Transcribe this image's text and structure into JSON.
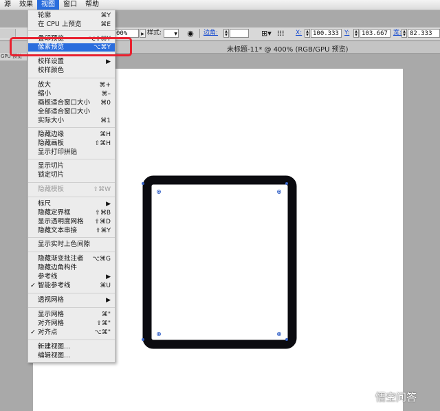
{
  "menubar": {
    "items": [
      {
        "label": "源",
        "active": false
      },
      {
        "label": "效果",
        "active": false
      },
      {
        "label": "视图",
        "active": true
      },
      {
        "label": "窗口",
        "active": false
      },
      {
        "label": "帮助",
        "active": false
      }
    ]
  },
  "control_bar": {
    "zoom_value": "00%",
    "style_label": "样式:",
    "corner_label": "边角:",
    "x_label": "X:",
    "x_value": "100.333 p",
    "y_label": "Y:",
    "y_value": "103.667 p",
    "w_label": "宽:",
    "w_value": "82.333 p"
  },
  "document": {
    "title": "未标题-11* @ 400% (RGB/GPU 预览)",
    "side_tab": "GPU 预览"
  },
  "view_menu": {
    "items": [
      {
        "label": "轮廓",
        "shortcut": "⌘Y"
      },
      {
        "label": "在 CPU 上预览",
        "shortcut": "⌘E"
      },
      {
        "label": "叠印预览",
        "shortcut": "⌥⇧⌘Y"
      },
      {
        "label": "像素预览",
        "shortcut": "⌥⌘Y",
        "highlighted": true
      },
      {
        "label": "校样设置",
        "submenu": true
      },
      {
        "label": "校样颜色"
      },
      {
        "label": "放大",
        "shortcut": "⌘+"
      },
      {
        "label": "缩小",
        "shortcut": "⌘–"
      },
      {
        "label": "画板适合窗口大小",
        "shortcut": "⌘0"
      },
      {
        "label": "全部适合窗口大小",
        "shortcut": ""
      },
      {
        "label": "实际大小",
        "shortcut": "⌘1"
      },
      {
        "label": "隐藏边缘",
        "shortcut": "⌘H"
      },
      {
        "label": "隐藏画板",
        "shortcut": "⇧⌘H"
      },
      {
        "label": "显示打印拼贴"
      },
      {
        "label": "显示切片"
      },
      {
        "label": "锁定切片"
      },
      {
        "label": "隐藏模板",
        "shortcut": "⇧⌘W",
        "disabled": true
      },
      {
        "label": "标尺",
        "submenu": true
      },
      {
        "label": "隐藏定界框",
        "shortcut": "⇧⌘B"
      },
      {
        "label": "显示透明度网格",
        "shortcut": "⇧⌘D"
      },
      {
        "label": "隐藏文本串接",
        "shortcut": "⇧⌘Y"
      },
      {
        "label": "显示实时上色间隙"
      },
      {
        "label": "隐藏渐变批注者",
        "shortcut": "⌥⌘G"
      },
      {
        "label": "隐藏边角构件"
      },
      {
        "label": "参考线",
        "submenu": true
      },
      {
        "label": "智能参考线",
        "shortcut": "⌘U",
        "checked": true
      },
      {
        "label": "透视网格",
        "submenu": true
      },
      {
        "label": "显示网格",
        "shortcut": "⌘\""
      },
      {
        "label": "对齐网格",
        "shortcut": "⇧⌘\""
      },
      {
        "label": "对齐点",
        "shortcut": "⌥⌘\"",
        "checked": true
      },
      {
        "label": "新建视图..."
      },
      {
        "label": "编辑视图..."
      }
    ]
  },
  "icons": {
    "submenu": "chevron-right-icon",
    "check": "checkmark-icon",
    "anchor": "anchor-point-icon",
    "watermark": "chat-bubble-icon"
  },
  "colors": {
    "accent": "#2a6ddd",
    "annotation": "#e8212f",
    "shape_stroke": "#0b0b10",
    "anchor": "#3a66c8"
  },
  "watermark": {
    "text": "悟空问答"
  }
}
